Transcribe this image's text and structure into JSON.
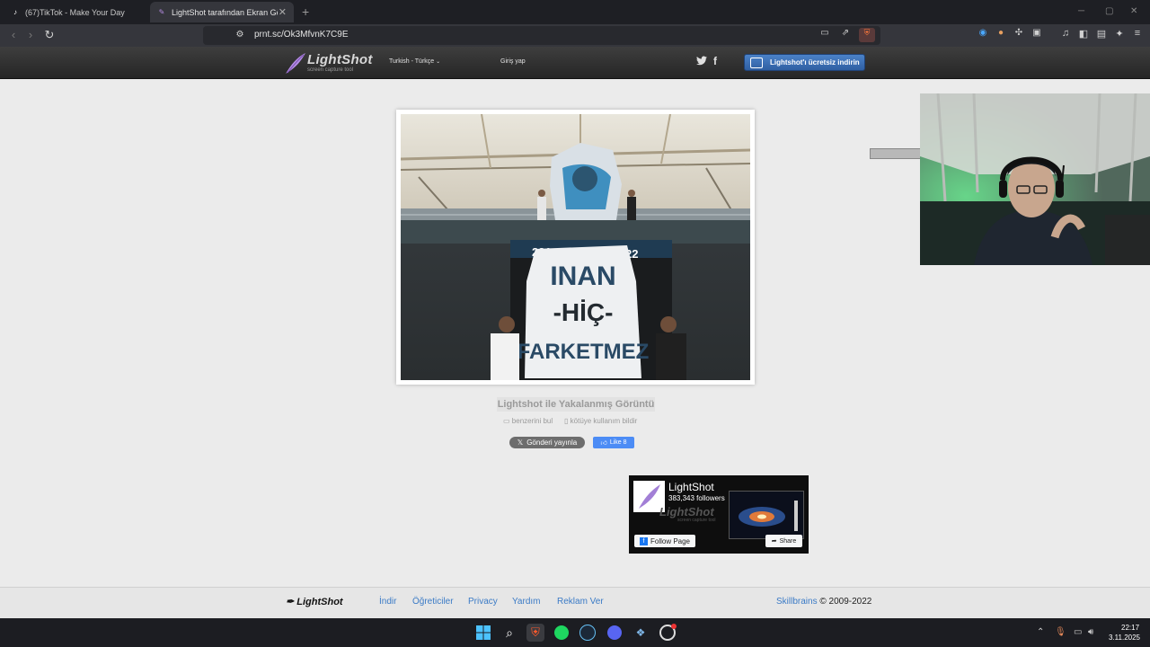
{
  "browser": {
    "tabs": [
      {
        "title": "(67)TikTok - Make Your Day"
      },
      {
        "title": "LightShot tarafından Ekran Görü"
      }
    ],
    "url": "prnt.sc/Ok3MfvnK7C9E"
  },
  "header": {
    "logo_title": "LightShot",
    "logo_subtitle": "screen capture tool",
    "language": "Turkish - Türkçe",
    "login": "Giriş yap",
    "download_label": "Lightshot'ı ücretsiz indirin"
  },
  "screenshot": {
    "caption": "Lightshot ile Yakalanmış Görüntü",
    "find_similar": "benzerini bul",
    "report_abuse": "kötüye kullanım bildir",
    "tweet_label": "Gönderi yayınla",
    "like_label": "Like 8",
    "photo": {
      "gate_left": "221",
      "gate_right": "22",
      "banner_lines": [
        "INAN",
        "-HİÇ-",
        "FARKETMEZ"
      ]
    }
  },
  "facebook_widget": {
    "page_name": "LightShot",
    "followers": "383,343 followers",
    "follow_label": "Follow Page",
    "share_label": "Share",
    "cover_logo": "LightShot",
    "cover_sub": "screen capture tool"
  },
  "footer": {
    "logo": "LightShot",
    "links": [
      "İndir",
      "Öğreticiler",
      "Privacy",
      "Yardım",
      "Reklam Ver"
    ],
    "company": "Skillbrains",
    "copyright": "© 2009-2022"
  },
  "taskbar": {
    "time": "22:17",
    "date": "3.11.2025"
  },
  "colors": {
    "page_bg": "#ebebeb",
    "header_bg": "#2e2e2e",
    "accent_blue": "#3b7bc6",
    "download_blue": "#3c6fb5"
  }
}
